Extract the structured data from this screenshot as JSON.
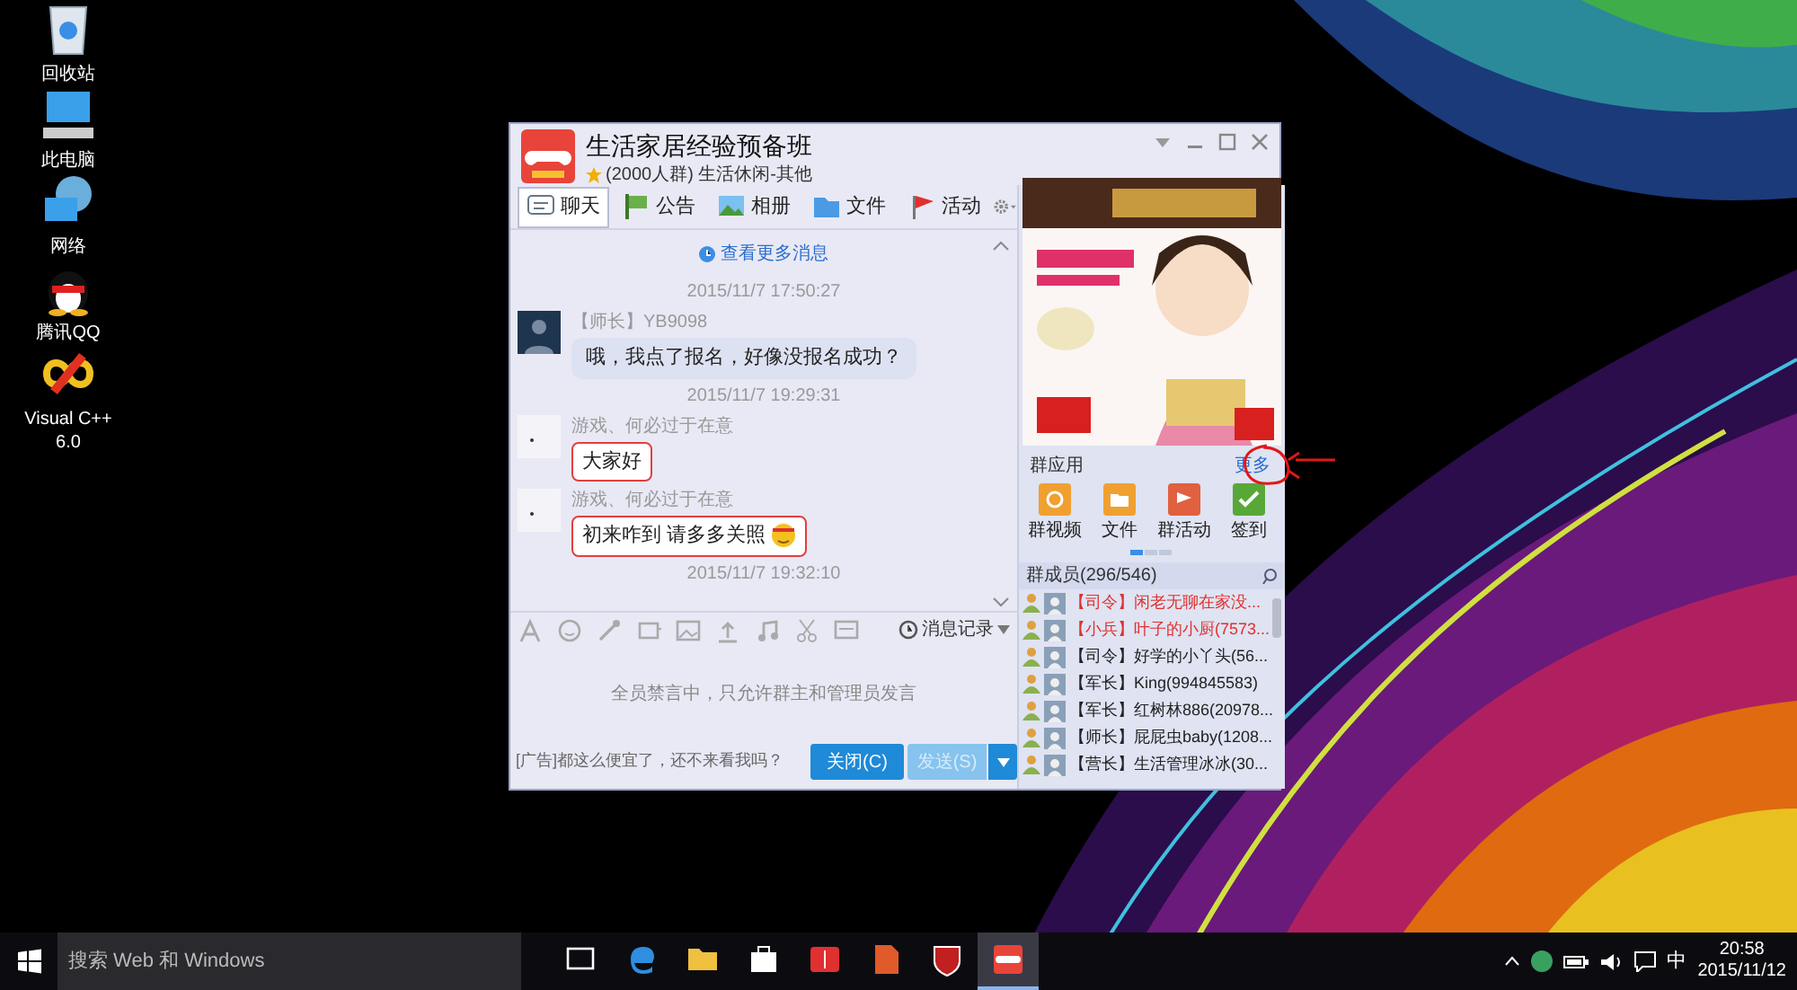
{
  "desktop_icons": [
    {
      "label": "回收站",
      "kind": "recycle"
    },
    {
      "label": "此电脑",
      "kind": "computer"
    },
    {
      "label": "网络",
      "kind": "network"
    },
    {
      "label": "腾讯QQ",
      "kind": "qq"
    },
    {
      "label": "Visual C++ 6.0",
      "kind": "vc"
    }
  ],
  "window": {
    "title": "生活家居经验预备班",
    "subtitle": "(2000人群) 生活休闲-其他",
    "tabs": [
      {
        "label": "聊天",
        "kind": "chat",
        "selected": true
      },
      {
        "label": "公告",
        "kind": "notice",
        "selected": false
      },
      {
        "label": "相册",
        "kind": "album",
        "selected": false
      },
      {
        "label": "文件",
        "kind": "folder",
        "selected": false
      },
      {
        "label": "活动",
        "kind": "event",
        "selected": false
      }
    ],
    "more_messages": "查看更多消息",
    "messages": [
      {
        "kind": "time",
        "text": "2015/11/7 17:50:27"
      },
      {
        "kind": "plain",
        "sender": "【师长】YB9098",
        "text": "哦，我点了报名，好像没报名成功？"
      },
      {
        "kind": "time",
        "text": "2015/11/7 19:29:31"
      },
      {
        "kind": "fancy",
        "sender": "游戏、何必过于在意",
        "text": "大家好",
        "emoji": false
      },
      {
        "kind": "fancy",
        "sender": "游戏、何必过于在意",
        "text": "初来咋到 请多多关照",
        "emoji": true
      },
      {
        "kind": "time",
        "text": "2015/11/7 19:32:10"
      }
    ],
    "history_button": "消息记录",
    "muted_notice": "全员禁言中，只允许群主和管理员发言",
    "ad_text": "[广告]都这么便宜了，还不来看我吗？",
    "close_button": "关闭(C)",
    "send_button": {
      "label": "发送(S)",
      "disabled": true
    },
    "apps_title": "群应用",
    "apps_more": "更多",
    "apps": [
      {
        "label": "群视频",
        "kind": "video"
      },
      {
        "label": "文件",
        "kind": "folder"
      },
      {
        "label": "群活动",
        "kind": "event"
      },
      {
        "label": "签到",
        "kind": "checkin"
      }
    ],
    "members_title": "群成员(296/546)",
    "members": [
      {
        "role": "【司令】",
        "name": "闲老无聊在家没...",
        "color": "#e03030"
      },
      {
        "role": "【小兵】",
        "name": "叶子的小厨(7573...",
        "color": "#e03030"
      },
      {
        "role": "【司令】",
        "name": "好学的小丫头(56...",
        "color": "#222222"
      },
      {
        "role": "【军长】",
        "name": "King(994845583)",
        "color": "#222222"
      },
      {
        "role": "【军长】",
        "name": "红树林886(20978...",
        "color": "#222222"
      },
      {
        "role": "【师长】",
        "name": "屁屁虫baby(1208...",
        "color": "#222222"
      },
      {
        "role": "【营长】",
        "name": "生活管理冰冰(30...",
        "color": "#222222"
      }
    ]
  },
  "taskbar": {
    "search_placeholder": "搜索 Web 和 Windows",
    "apps": [
      {
        "kind": "taskview",
        "active": false
      },
      {
        "kind": "edge",
        "active": false
      },
      {
        "kind": "explorer",
        "active": false
      },
      {
        "kind": "store",
        "active": false
      },
      {
        "kind": "book",
        "active": false
      },
      {
        "kind": "document",
        "active": false
      },
      {
        "kind": "shield",
        "active": false
      },
      {
        "kind": "game",
        "active": true
      }
    ],
    "ime": "中",
    "time": "20:58",
    "date": "2015/11/12"
  }
}
